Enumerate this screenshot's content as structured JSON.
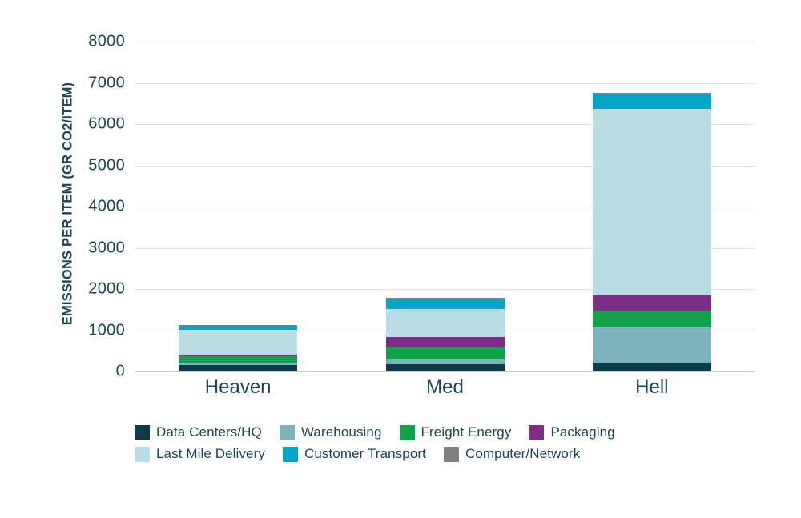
{
  "chart_data": {
    "type": "bar",
    "stacked": true,
    "title": "",
    "xlabel": "",
    "ylabel": "EMISSIONS PER ITEM (GR CO2/ITEM)",
    "categories": [
      "Heaven",
      "Med",
      "Hell"
    ],
    "ylim": [
      0,
      8000
    ],
    "yticks": [
      0,
      1000,
      2000,
      3000,
      4000,
      5000,
      6000,
      7000,
      8000
    ],
    "ytick_labels": [
      "0",
      "1000",
      "2000",
      "3000",
      "4000",
      "5000",
      "6000",
      "7000",
      "8000"
    ],
    "grid": true,
    "legend_position": "bottom",
    "series": [
      {
        "name": "Data Centers/HQ",
        "color": "#0E3B47",
        "values": [
          150,
          180,
          210
        ]
      },
      {
        "name": "Warehousing",
        "color": "#7FB2BC",
        "values": [
          60,
          120,
          850
        ]
      },
      {
        "name": "Freight Energy",
        "color": "#12A24A",
        "values": [
          160,
          290,
          420
        ]
      },
      {
        "name": "Packaging",
        "color": "#7D2E86",
        "values": [
          40,
          250,
          380
        ]
      },
      {
        "name": "Last Mile Delivery",
        "color": "#B8DDE4",
        "values": [
          600,
          680,
          4500
        ]
      },
      {
        "name": "Customer Transport",
        "color": "#00A5C8",
        "values": [
          100,
          230,
          350
        ]
      },
      {
        "name": "Computer/Network",
        "color": "#808080",
        "values": [
          20,
          30,
          40
        ]
      }
    ],
    "totals": [
      1130,
      1780,
      6750
    ]
  },
  "style": {
    "text_color": "#1a4552",
    "grid_color": "#e2e2e2",
    "background": "#ffffff"
  }
}
